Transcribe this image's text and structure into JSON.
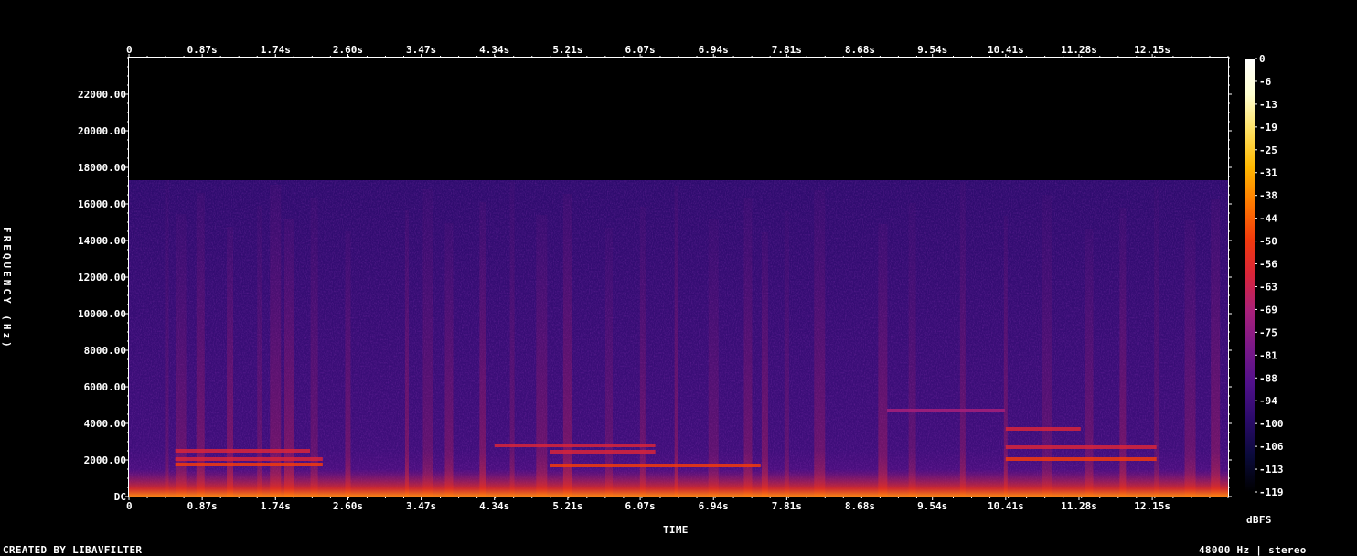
{
  "chart_data": {
    "type": "heatmap",
    "xlabel": "TIME",
    "ylabel": "FREQUENCY (Hz)",
    "x_ticks": [
      "0",
      "0.87s",
      "1.74s",
      "2.60s",
      "3.47s",
      "4.34s",
      "5.21s",
      "6.07s",
      "6.94s",
      "7.81s",
      "8.68s",
      "9.54s",
      "10.41s",
      "11.28s",
      "12.15s"
    ],
    "x_tick_values": [
      0,
      0.87,
      1.74,
      2.6,
      3.47,
      4.34,
      5.21,
      6.07,
      6.94,
      7.81,
      8.68,
      9.54,
      10.41,
      11.28,
      12.15
    ],
    "xlim": [
      0,
      13.05
    ],
    "y_ticks": [
      "DC",
      "2000.00",
      "4000.00",
      "6000.00",
      "8000.00",
      "10000.00",
      "12000.00",
      "14000.00",
      "16000.00",
      "18000.00",
      "20000.00",
      "22000.00"
    ],
    "y_tick_values": [
      0,
      2000,
      4000,
      6000,
      8000,
      10000,
      12000,
      14000,
      16000,
      18000,
      20000,
      22000
    ],
    "ylim": [
      0,
      24000
    ],
    "content_cutoff_hz": 17300,
    "colorbar": {
      "label": "dBFS",
      "ticks": [
        "0",
        "-6",
        "-13",
        "-19",
        "-25",
        "-31",
        "-38",
        "-44",
        "-50",
        "-56",
        "-63",
        "-69",
        "-75",
        "-81",
        "-88",
        "-94",
        "-100",
        "-106",
        "-113",
        "-119"
      ],
      "range": [
        -119,
        0
      ],
      "colormap": [
        "#000000",
        "#0a0a3a",
        "#2a0a6a",
        "#50108a",
        "#7a1888",
        "#a8207a",
        "#d8243a",
        "#f23a0c",
        "#ff7a00",
        "#ffb800",
        "#ffe060",
        "#ffffd0",
        "#ffffff"
      ]
    },
    "tonal_lines": [
      {
        "t0": 0.55,
        "t1": 2.15,
        "f": 2500,
        "db": -60
      },
      {
        "t0": 0.55,
        "t1": 2.3,
        "f": 2050,
        "db": -55
      },
      {
        "t0": 0.55,
        "t1": 2.3,
        "f": 1750,
        "db": -52
      },
      {
        "t0": 4.34,
        "t1": 6.25,
        "f": 2800,
        "db": -62
      },
      {
        "t0": 5.0,
        "t1": 6.25,
        "f": 2450,
        "db": -60
      },
      {
        "t0": 5.0,
        "t1": 7.5,
        "f": 1700,
        "db": -54
      },
      {
        "t0": 9.0,
        "t1": 10.4,
        "f": 4700,
        "db": -70
      },
      {
        "t0": 10.41,
        "t1": 12.2,
        "f": 2050,
        "db": -50
      },
      {
        "t0": 10.41,
        "t1": 12.2,
        "f": 2700,
        "db": -58
      },
      {
        "t0": 10.41,
        "t1": 11.3,
        "f": 3700,
        "db": -62
      }
    ]
  },
  "footer": {
    "credit": "CREATED BY LIBAVFILTER",
    "format": "48000 Hz | stereo"
  }
}
